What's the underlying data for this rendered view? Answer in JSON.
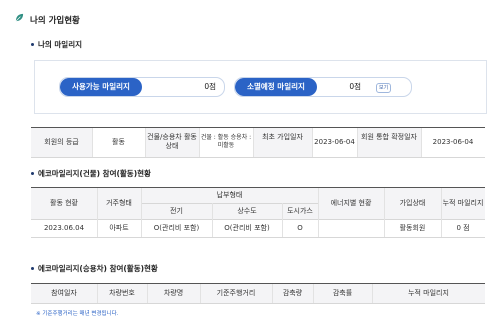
{
  "title": "나의 가입현황",
  "mileage_section": {
    "heading": "나의 마일리지",
    "available_label": "사용가능 마일리지",
    "available_value": "0점",
    "expiring_label": "소멸예정 마일리지",
    "expiring_value": "0점",
    "help_label": "보기"
  },
  "member_info": {
    "cells": [
      "회원의 등급",
      "활동",
      "건물/승용차\n활동상태",
      "건물 : 활동\n승용차 : 미활동",
      "최초\n가입일자",
      "2023-06-04",
      "회원 통합\n확정일자",
      "2023-06-04"
    ]
  },
  "building_section": {
    "heading": "에코마일리지(건물) 참여(활동)현황",
    "headers": {
      "activity": "활동 현황",
      "housing_type": "거주형태",
      "payment_type": "납부형태",
      "electricity": "전기",
      "water": "상수도",
      "gas": "도시가스",
      "energy_status": "에너지별 현황",
      "join_status": "가입상태",
      "cumulative": "누적 마일리지"
    },
    "row": {
      "date": "2023.06.04",
      "housing": "아파트",
      "electricity": "O(관리비 포함)",
      "water": "O(관리비 포함)",
      "gas": "O",
      "energy": "",
      "join": "활동회원",
      "mileage": "0 점"
    }
  },
  "car_section": {
    "heading": "에코마일리지(승용차) 참여(활동)현황",
    "headers": [
      "참여일자",
      "차량번호",
      "차량명",
      "기준주행거리",
      "감축량",
      "감축률",
      "누적 마일리지"
    ]
  },
  "footnote": "※ 기준주행거리는 매년 변경됩니다.",
  "colors": {
    "accent": "#2b63c6",
    "leaf": "#2f8f83",
    "header_bg": "#f4f4f6"
  }
}
